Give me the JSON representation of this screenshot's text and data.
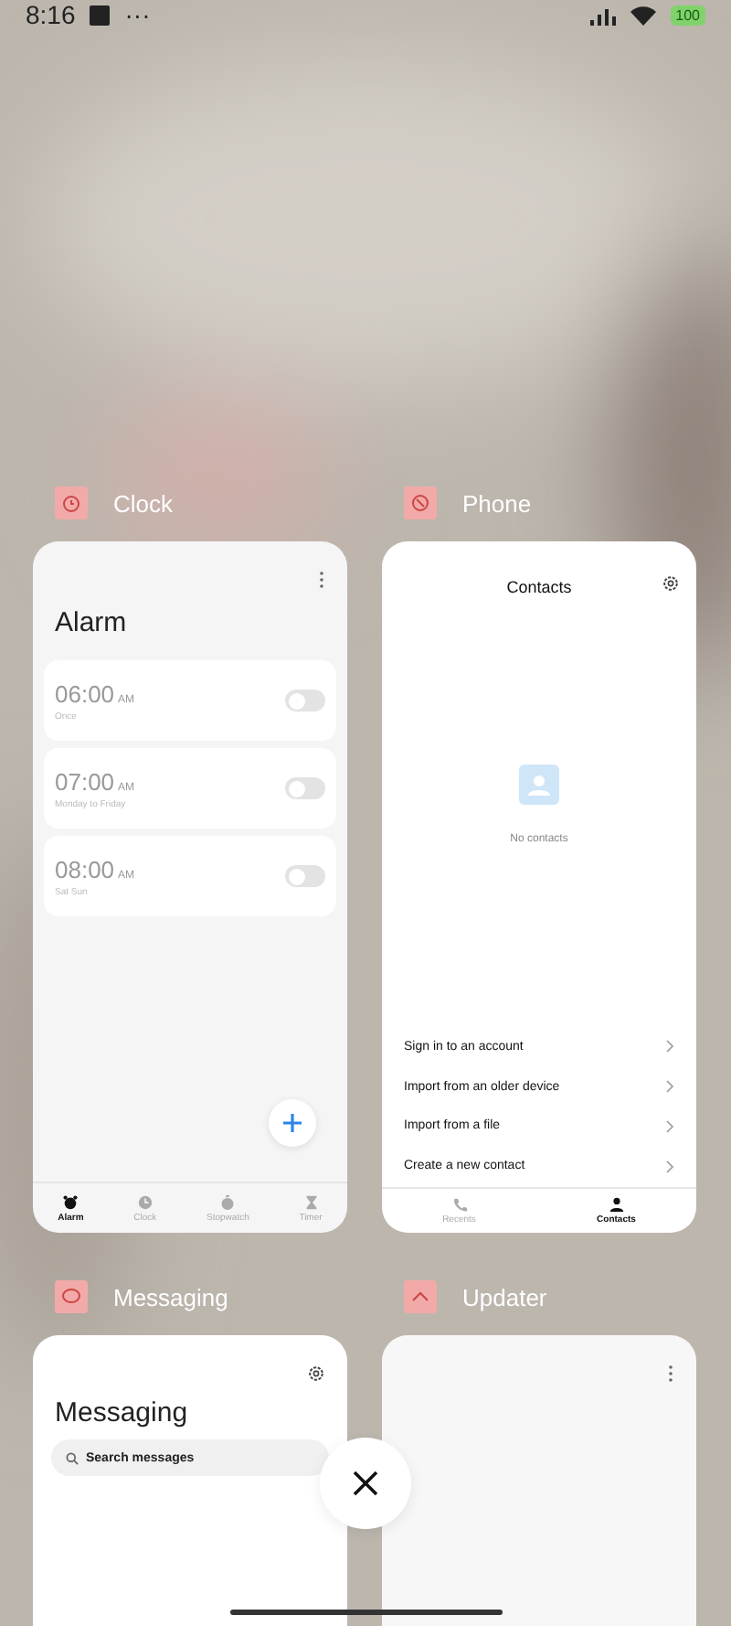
{
  "status_bar": {
    "time": "8:16",
    "overflow": "···",
    "battery": "100"
  },
  "apps": [
    {
      "kind": "clock",
      "name": "Clock",
      "title": "Alarm",
      "alarms": [
        {
          "time": "06:00",
          "period": "AM",
          "repeat": "Once",
          "on": false
        },
        {
          "time": "07:00",
          "period": "AM",
          "repeat": "Monday to Friday",
          "on": false
        },
        {
          "time": "08:00",
          "period": "AM",
          "repeat": "Sat Sun",
          "on": false
        }
      ],
      "tabs": [
        {
          "label": "Alarm",
          "selected": true
        },
        {
          "label": "Clock",
          "selected": false
        },
        {
          "label": "Stopwatch",
          "selected": false
        },
        {
          "label": "Timer",
          "selected": false
        }
      ]
    },
    {
      "kind": "phone",
      "name": "Phone",
      "title": "Contacts",
      "empty_text": "No contacts",
      "options": [
        "Sign in to an account",
        "Import from an older device",
        "Import from a file",
        "Create a new contact"
      ],
      "tabs": [
        {
          "label": "Recents",
          "selected": false
        },
        {
          "label": "Contacts",
          "selected": true
        }
      ]
    },
    {
      "kind": "messaging",
      "name": "Messaging",
      "title": "Messaging",
      "search": {
        "placeholder": "Search messages"
      }
    },
    {
      "kind": "updater",
      "name": "Updater"
    }
  ]
}
